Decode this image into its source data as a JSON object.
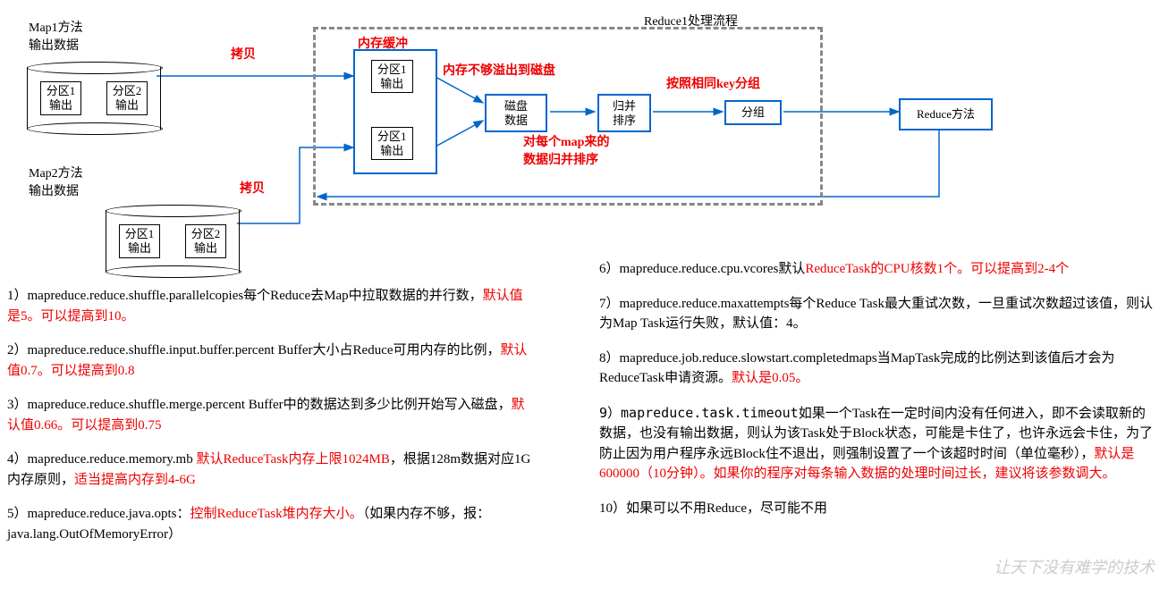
{
  "diagram": {
    "map1_title": "Map1方法\n输出数据",
    "map2_title": "Map2方法\n输出数据",
    "partition1": "分区1\n输出",
    "partition2": "分区2\n输出",
    "copy1": "拷贝",
    "copy2": "拷贝",
    "mem_buffer": "内存缓冲",
    "spill_label": "内存不够溢出到磁盘",
    "disk_data": "磁盘\n数据",
    "merge_sort": "归并\n排序",
    "merge_note": "对每个map来的\n数据归并排序",
    "group": "分组",
    "group_note": "按照相同key分组",
    "reduce_method": "Reduce方法",
    "reduce_flow": "Reduce1处理流程"
  },
  "left": {
    "t1a": "1）mapreduce.reduce.shuffle.parallelcopies每个Reduce去Map中拉取数据的并行数，",
    "t1b": "默认值是5。可以提高到10。",
    "t2a": "2）mapreduce.reduce.shuffle.input.buffer.percent Buffer大小占Reduce可用内存的比例，",
    "t2b": "默认值0.7。可以提高到0.8",
    "t3a": "3）mapreduce.reduce.shuffle.merge.percent Buffer中的数据达到多少比例开始写入磁盘，",
    "t3b": "默认值0.66。可以提高到0.75",
    "t4a": "4）mapreduce.reduce.memory.mb ",
    "t4b": "默认ReduceTask内存上限1024MB",
    "t4c": "，根据128m数据对应1G内存原则，",
    "t4d": "适当提高内存到4-6G",
    "t5a": "5）mapreduce.reduce.java.opts：",
    "t5b": "控制ReduceTask堆内存大小。",
    "t5c": "（如果内存不够，报：java.lang.OutOfMemoryError）"
  },
  "right": {
    "t6a": "6）mapreduce.reduce.cpu.vcores默认",
    "t6b": "ReduceTask的CPU核数1个。可以提高到2-4个",
    "t7a": "7）mapreduce.reduce.maxattempts每个Reduce Task最大重试次数，一旦重试次数超过该值，则认为Map Task运行失败，默认值：4。",
    "t8a": "8）mapreduce.job.reduce.slowstart.completedmaps当MapTask完成的比例达到该值后才会为ReduceTask申请资源。",
    "t8b": "默认是0.05。",
    "t9a": "9）mapreduce.task.timeout",
    "t9b": "如果一个Task在一定时间内没有任何进入，即不会读取新的数据，也没有输出数据，则认为该Task处于Block状态，可能是卡住了，也许永远会卡住，为了防止因为用户程序永远Block住不退出，则强制设置了一个该超时时间（单位毫秒），",
    "t9c": "默认是600000（10分钟）。如果你的程序对每条输入数据的处理时间过长，建议将该参数调大。",
    "t10a": "10）如果可以不用Reduce，尽可能不用"
  },
  "watermark": "让天下没有难学的技术"
}
